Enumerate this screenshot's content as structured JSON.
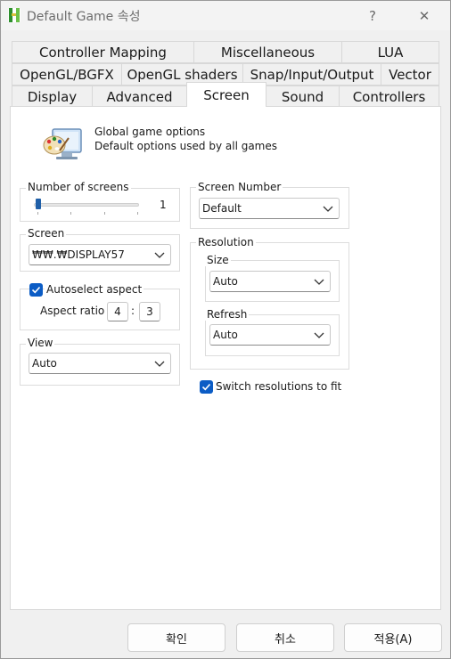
{
  "window": {
    "title": "Default Game 속성",
    "help_symbol": "?",
    "close_symbol": "✕"
  },
  "tabs": {
    "row1": [
      "Controller Mapping",
      "Miscellaneous",
      "LUA"
    ],
    "row2": [
      "OpenGL/BGFX",
      "OpenGL shaders",
      "Snap/Input/Output",
      "Vector"
    ],
    "row3": [
      "Display",
      "Advanced",
      "Screen",
      "Sound",
      "Controllers"
    ],
    "active": "Screen"
  },
  "info": {
    "line1": "Global game options",
    "line2": "Default options used by all games"
  },
  "screens_group": {
    "label": "Number of screens",
    "value": "1"
  },
  "screen_group": {
    "label": "Screen",
    "value": "₩₩.₩DISPLAY57"
  },
  "aspect_group": {
    "checkbox_label": "Autoselect aspect",
    "checked": true,
    "ratio_label": "Aspect ratio",
    "ratio_w": "4",
    "ratio_sep": ":",
    "ratio_h": "3"
  },
  "view_group": {
    "label": "View",
    "value": "Auto"
  },
  "screen_number_group": {
    "label": "Screen Number",
    "value": "Default"
  },
  "resolution_group": {
    "label": "Resolution",
    "size_label": "Size",
    "size_value": "Auto",
    "refresh_label": "Refresh",
    "refresh_value": "Auto"
  },
  "switch_res": {
    "label": "Switch resolutions to fit",
    "checked": true
  },
  "footer": {
    "ok": "확인",
    "cancel": "취소",
    "apply": "적용(A)"
  },
  "colors": {
    "accent": "#0b5cc5",
    "panel_bg": "#ffffff",
    "window_bg": "#f0f0f0"
  },
  "icons": [
    "app-logo-icon",
    "help-icon",
    "close-icon",
    "palette-icon",
    "chevron-down-icon",
    "checkmark-icon"
  ]
}
